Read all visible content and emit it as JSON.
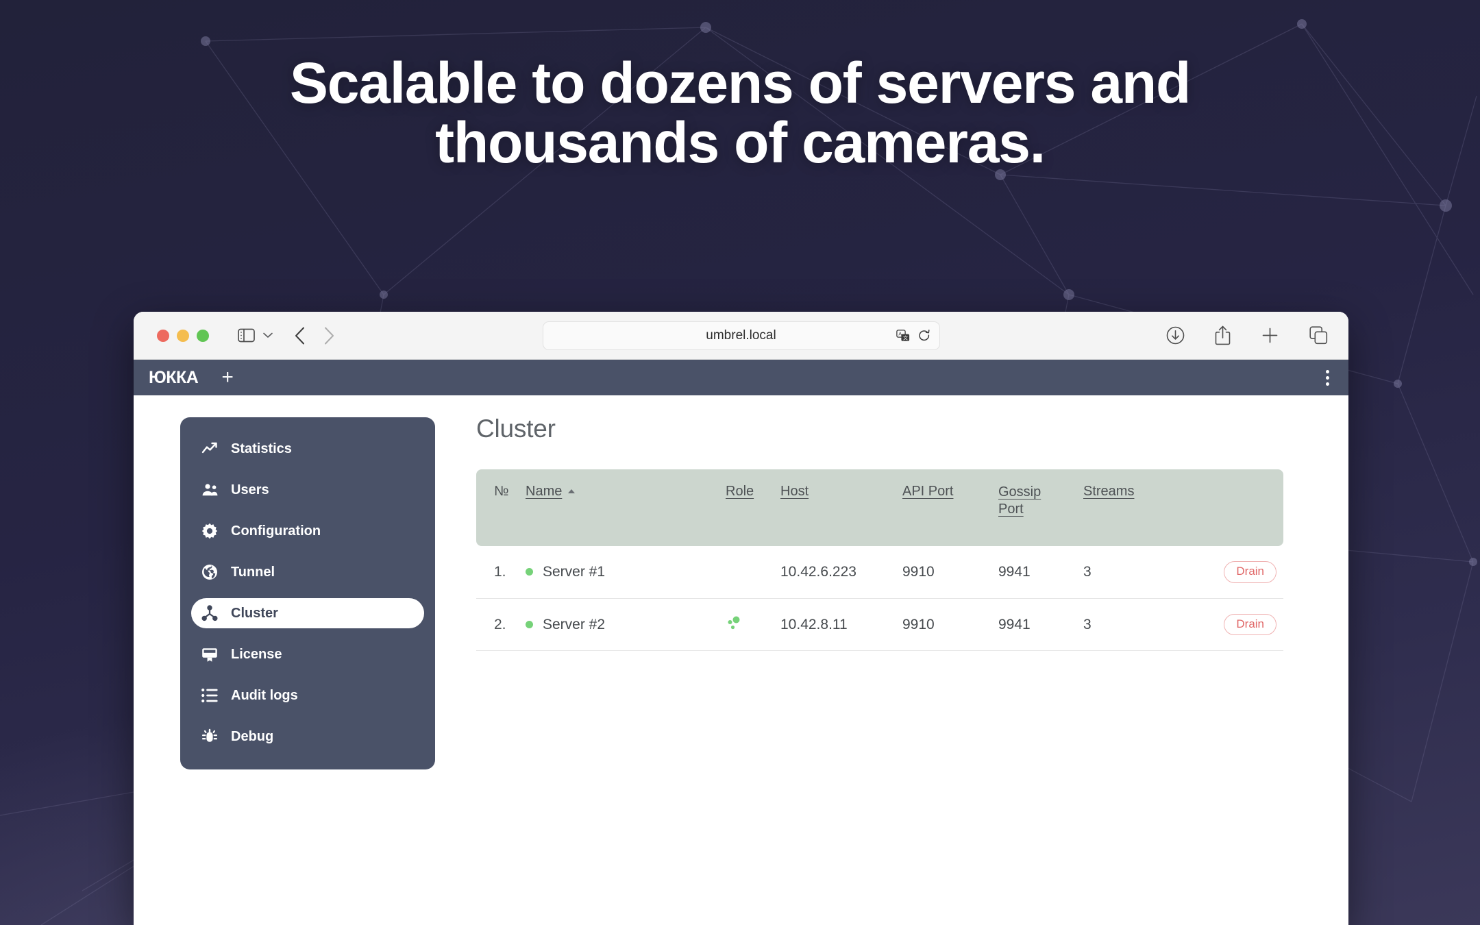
{
  "headline": {
    "line1": "Scalable to dozens of servers and",
    "line2": "thousands of cameras."
  },
  "browser": {
    "url": "umbrel.local",
    "traffic_lights": [
      "close",
      "minimize",
      "zoom"
    ],
    "toolbar_icons": [
      "sidebar-toggle-icon",
      "chevron-down-icon",
      "back-arrow-icon",
      "forward-arrow-icon",
      "translate-icon",
      "reload-icon",
      "downloads-icon",
      "share-icon",
      "new-tab-icon",
      "tab-overview-icon"
    ]
  },
  "app": {
    "logo_text": "ЮККА",
    "new_tab_label": "+",
    "menu_label": "⋮"
  },
  "sidebar": {
    "items": [
      {
        "label": "Statistics",
        "icon": "chart-line-icon",
        "active": false
      },
      {
        "label": "Users",
        "icon": "users-icon",
        "active": false
      },
      {
        "label": "Configuration",
        "icon": "gear-icon",
        "active": false
      },
      {
        "label": "Tunnel",
        "icon": "globe-icon",
        "active": false
      },
      {
        "label": "Cluster",
        "icon": "cluster-icon",
        "active": true
      },
      {
        "label": "License",
        "icon": "license-icon",
        "active": false
      },
      {
        "label": "Audit logs",
        "icon": "list-icon",
        "active": false
      },
      {
        "label": "Debug",
        "icon": "bug-icon",
        "active": false
      }
    ]
  },
  "main": {
    "title": "Cluster",
    "table": {
      "columns": [
        {
          "key": "no",
          "label": "№",
          "sortable": false,
          "sorted": null
        },
        {
          "key": "name",
          "label": "Name",
          "sortable": true,
          "sorted": "asc"
        },
        {
          "key": "role",
          "label": "Role",
          "sortable": true,
          "sorted": null
        },
        {
          "key": "host",
          "label": "Host",
          "sortable": true,
          "sorted": null
        },
        {
          "key": "api",
          "label": "API Port",
          "sortable": true,
          "sorted": null
        },
        {
          "key": "gossip",
          "label": "Gossip Port",
          "sortable": true,
          "sorted": null
        },
        {
          "key": "streams",
          "label": "Streams",
          "sortable": true,
          "sorted": null
        },
        {
          "key": "action",
          "label": "",
          "sortable": false,
          "sorted": null
        }
      ],
      "rows": [
        {
          "no": "1.",
          "name": "Server #1",
          "status": "online",
          "role_icon": "",
          "host": "10.42.6.223",
          "api_port": "9910",
          "gossip_port": "9941",
          "streams": "3",
          "action_label": "Drain"
        },
        {
          "no": "2.",
          "name": "Server #2",
          "status": "online",
          "role_icon": "cluster-leader-icon",
          "host": "10.42.8.11",
          "api_port": "9910",
          "gossip_port": "9941",
          "streams": "3",
          "action_label": "Drain"
        }
      ]
    }
  },
  "colors": {
    "app_header": "#4a5268",
    "sidebar": "#4a5268",
    "table_header": "#ccd6ce",
    "status_online": "#76d279",
    "drain_border": "#f0b2b2",
    "drain_text": "#e06767",
    "background_dark": "#22223a",
    "background_light": "#3b3859"
  }
}
